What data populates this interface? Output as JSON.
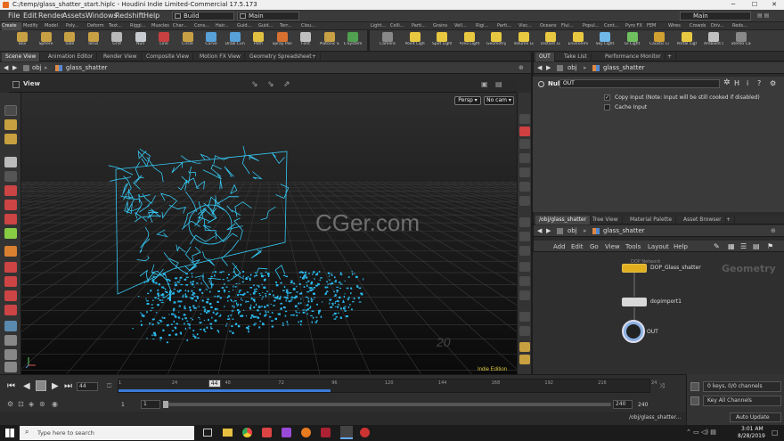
{
  "window": {
    "title": "C:/temp/glass_shatter_start.hiplc - Houdini Indie Limited-Commercial 17.5.173",
    "min": "─",
    "max": "☐",
    "close": "✕"
  },
  "menu": {
    "items": [
      "File",
      "Edit",
      "Render",
      "Assets",
      "Windows",
      "Redshift",
      "Help"
    ],
    "desktop": "Build",
    "context": "Main",
    "main_right": "Main"
  },
  "shelf_tabs": [
    "Create",
    "Modify",
    "Model",
    "Poly...",
    "Deform",
    "Text...",
    "Riggi...",
    "Muscles",
    "Char...",
    "Cons...",
    "Hair...",
    "Guid...",
    "Guid...",
    "Terr...",
    "Clou...",
    "Light...",
    "Colli...",
    "Parti...",
    "Grains",
    "Vell...",
    "Rigi...",
    "Parti...",
    "Visc...",
    "Oceans",
    "Flui...",
    "Popul...",
    "Cont...",
    "Pyro FX",
    "FEM",
    "Wires",
    "Crowds",
    "Driv...",
    "Reds..."
  ],
  "tools_left": [
    {
      "label": "Box",
      "icon": "box-icon",
      "color": "#c8a044"
    },
    {
      "label": "Sphere",
      "icon": "sphere-icon",
      "color": "#c8a044"
    },
    {
      "label": "Tube",
      "icon": "tube-icon",
      "color": "#c8a044"
    },
    {
      "label": "Torus",
      "icon": "torus-icon",
      "color": "#c8a044"
    },
    {
      "label": "Grid",
      "icon": "grid-icon",
      "color": "#b8b8b8"
    },
    {
      "label": "Null",
      "icon": "null-icon",
      "color": "#c9ccd0"
    },
    {
      "label": "Line",
      "icon": "line-icon",
      "color": "#c84040"
    },
    {
      "label": "Circle",
      "icon": "circle-icon",
      "color": "#c8a044"
    },
    {
      "label": "Curve",
      "icon": "curve-icon",
      "color": "#58a0d8"
    },
    {
      "label": "Draw Curve",
      "icon": "draw-curve-icon",
      "color": "#58a0d8"
    },
    {
      "label": "Path",
      "icon": "path-icon",
      "color": "#e0c040"
    },
    {
      "label": "Spray Paint",
      "icon": "spray-paint-icon",
      "color": "#d87030"
    },
    {
      "label": "Font",
      "icon": "font-icon",
      "color": "#c0c0c0"
    },
    {
      "label": "Platonic Solids",
      "icon": "platonic-icon",
      "color": "#c8a044"
    },
    {
      "label": "L-System",
      "icon": "l-system-icon",
      "color": "#50a050"
    }
  ],
  "tools_right": [
    {
      "label": "Camera",
      "icon": "camera-icon",
      "color": "#888888"
    },
    {
      "label": "Point Light",
      "icon": "point-light-icon",
      "color": "#e8c840"
    },
    {
      "label": "Spot Light",
      "icon": "spot-light-icon",
      "color": "#e8c840"
    },
    {
      "label": "Area Light",
      "icon": "area-light-icon",
      "color": "#e8c840"
    },
    {
      "label": "Geometry Light",
      "icon": "geometry-light-icon",
      "color": "#e8c840"
    },
    {
      "label": "Volume Light",
      "icon": "volume-light-icon",
      "color": "#e8c840"
    },
    {
      "label": "Distant Light",
      "icon": "distant-light-icon",
      "color": "#e8c840"
    },
    {
      "label": "Environment Light",
      "icon": "environment-light-icon",
      "color": "#e8c840"
    },
    {
      "label": "Sky Light",
      "icon": "sky-light-icon",
      "color": "#70b8e8"
    },
    {
      "label": "GI Light",
      "icon": "gi-light-icon",
      "color": "#70c060"
    },
    {
      "label": "Caustic Light",
      "icon": "caustic-light-icon",
      "color": "#d0a030"
    },
    {
      "label": "Portal Light",
      "icon": "portal-light-icon",
      "color": "#e8c840"
    },
    {
      "label": "Ambient Light",
      "icon": "ambient-light-icon",
      "color": "#c0c0c0"
    },
    {
      "label": "Stereo Camera",
      "icon": "stereo-camera-icon",
      "color": "#888888"
    }
  ],
  "left_panel": {
    "tabs": [
      "Scene View",
      "Animation Editor",
      "Render View",
      "Composite View",
      "Motion FX View",
      "Geometry Spreadsheet"
    ],
    "path": [
      "obj",
      "glass_shatter"
    ],
    "view_label": "View",
    "persp": "Persp ▾",
    "cam": "No cam ▾",
    "watermark": "CGer.com",
    "edition": "Indie Edition",
    "grid_label": "20"
  },
  "right_top": {
    "tabs": [
      "OUT",
      "Take List",
      "Performance Monitor"
    ],
    "path": [
      "obj",
      "glass_shatter"
    ],
    "node_type": "Null",
    "node_name": "OUT",
    "params": [
      {
        "label": "Copy Input (Note: Input will be still cooked if disabled)",
        "checked": true
      },
      {
        "label": "Cache Input",
        "checked": false
      }
    ]
  },
  "right_bottom": {
    "tabs": [
      "/obj/glass_shatter",
      "Tree View",
      "Material Palette",
      "Asset Browser"
    ],
    "path": [
      "obj",
      "glass_shatter"
    ],
    "menu": [
      "Add",
      "Edit",
      "Go",
      "View",
      "Tools",
      "Layout",
      "Help"
    ],
    "context_label": "Geometry",
    "nodes": [
      {
        "type": "DOP Network",
        "name": "DOP_Glass_shatter",
        "color": "#e0b020"
      },
      {
        "type": "",
        "name": "dopimport1",
        "color": "#d8d8d8"
      },
      {
        "type": "",
        "name": "OUT",
        "color": "#8ab0e0"
      }
    ]
  },
  "timeline": {
    "ticks": [
      "1",
      "24",
      "48",
      "72",
      "96",
      "120",
      "144",
      "168",
      "192",
      "216",
      "24"
    ],
    "current_frame": "44",
    "frame_field": "44",
    "start": "1",
    "start2": "1",
    "end": "240",
    "end2": "240",
    "progress": 0.4
  },
  "status": {
    "keys": "0 keys, 0/0 channels",
    "key_all": "Key All Channels",
    "net_path": "/obj/glass_shatter...",
    "auto_update": "Auto Update"
  },
  "taskbar": {
    "search_placeholder": "Type here to search",
    "time": "3:01 AM",
    "date": "8/28/2019"
  }
}
